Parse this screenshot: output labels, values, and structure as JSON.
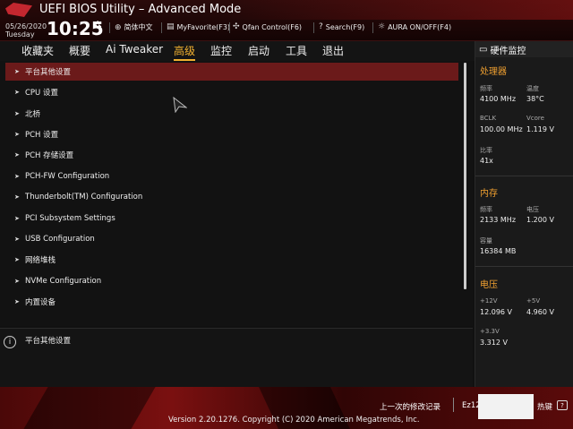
{
  "header": {
    "title": "UEFI BIOS Utility – Advanced Mode",
    "date": "05/26/2020",
    "day": "Tuesday",
    "time": "10:25",
    "items": [
      {
        "icon": "globe-icon",
        "label": "简体中文"
      },
      {
        "icon": "star-icon",
        "label": "MyFavorite(F3)"
      },
      {
        "icon": "fan-icon",
        "label": "Qfan Control(F6)"
      },
      {
        "icon": "search-icon",
        "label": "Search(F9)"
      },
      {
        "icon": "aura-icon",
        "label": "AURA ON/OFF(F4)"
      }
    ]
  },
  "nav": {
    "tabs": [
      "收藏夹",
      "概要",
      "Ai Tweaker",
      "高级",
      "监控",
      "启动",
      "工具",
      "退出"
    ],
    "active_index": 3
  },
  "menu": {
    "items": [
      "平台其他设置",
      "CPU 设置",
      "北桥",
      "PCH 设置",
      "PCH 存储设置",
      "PCH-FW Configuration",
      "Thunderbolt(TM) Configuration",
      "PCI Subsystem Settings",
      "USB Configuration",
      "网络堆栈",
      "NVMe Configuration",
      "内置设备"
    ],
    "selected_index": 0
  },
  "info": {
    "text": "平台其他设置"
  },
  "hwmon": {
    "title": "硬件监控",
    "cpu": {
      "section": "处理器",
      "freq_label": "频率",
      "freq_value": "4100 MHz",
      "temp_label": "温度",
      "temp_value": "38°C",
      "bclk_label": "BCLK",
      "bclk_value": "100.00 MHz",
      "vcore_label": "Vcore",
      "vcore_value": "1.119 V",
      "ratio_label": "比率",
      "ratio_value": "41x"
    },
    "memory": {
      "section": "内存",
      "freq_label": "频率",
      "freq_value": "2133 MHz",
      "volt_label": "电压",
      "volt_value": "1.200 V",
      "cap_label": "容量",
      "cap_value": "16384 MB"
    },
    "voltage": {
      "section": "电压",
      "v12_label": "+12V",
      "v12_value": "12.096 V",
      "v5_label": "+5V",
      "v5_value": "4.960 V",
      "v33_label": "+3.3V",
      "v33_value": "3.312 V"
    }
  },
  "footer": {
    "version": "Version 2.20.1276. Copyright (C) 2020 American Megatrends, Inc.",
    "last_changes": "上一次的修改记录",
    "ez": "Ez12",
    "hotkey": "热键"
  },
  "colors": {
    "accent": "#f0b030",
    "selected_bg": "#6b1a1a",
    "brand_red": "#c3272f"
  }
}
